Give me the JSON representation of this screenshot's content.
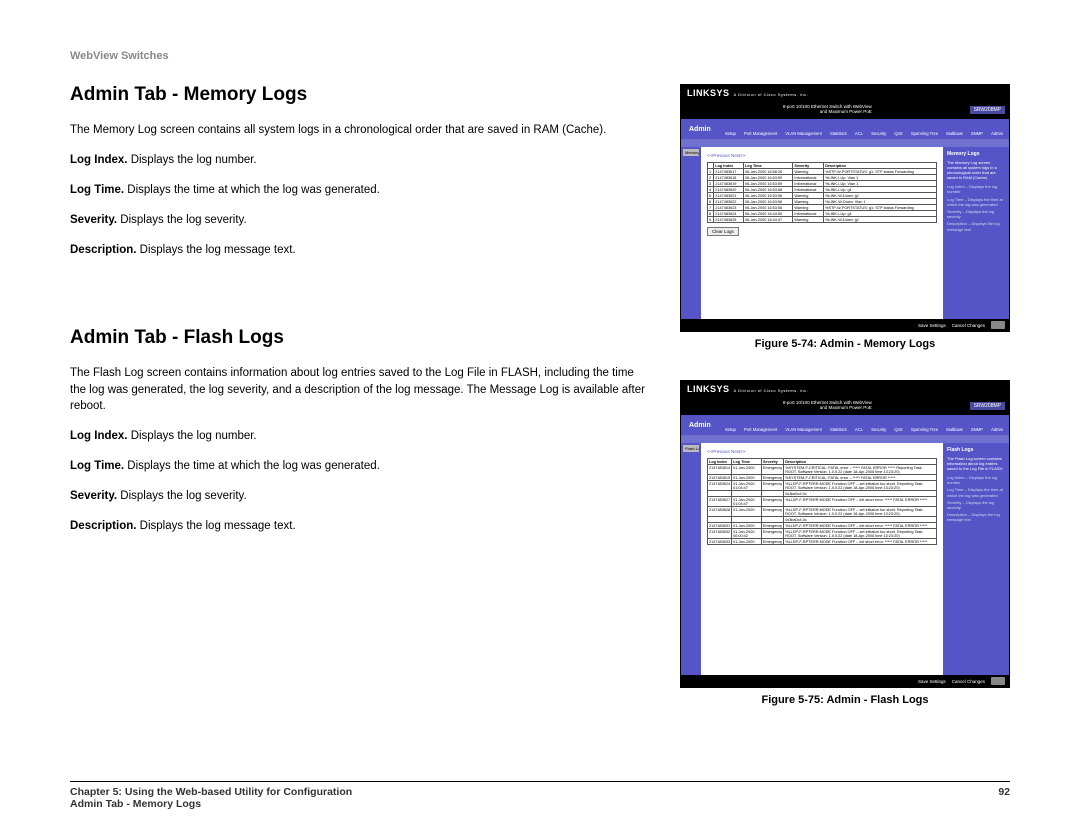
{
  "header_label": "WebView Switches",
  "section1": {
    "title": "Admin Tab - Memory Logs",
    "intro": "The Memory Log screen contains all system logs in a chronological order that are saved in RAM (Cache).",
    "fields": [
      {
        "label": "Log Index.",
        "text": " Displays the log number."
      },
      {
        "label": "Log Time.",
        "text": " Displays the time at which the log was generated."
      },
      {
        "label": "Severity.",
        "text": " Displays the log severity."
      },
      {
        "label": "Description.",
        "text": " Displays the log message text."
      }
    ]
  },
  "section2": {
    "title": "Admin Tab - Flash Logs",
    "intro": "The Flash Log screen contains information about log entries saved to the Log File in FLASH, including the time the log was generated, the log severity, and a description of the log message. The Message Log is available after reboot.",
    "fields": [
      {
        "label": "Log Index.",
        "text": " Displays the log number."
      },
      {
        "label": "Log Time.",
        "text": " Displays the time at which the log was generated."
      },
      {
        "label": "Severity.",
        "text": " Displays the log severity."
      },
      {
        "label": "Description.",
        "text": " Displays the log message text."
      }
    ]
  },
  "figures": {
    "fig1_caption": "Figure 5-74: Admin - Memory Logs",
    "fig2_caption": "Figure 5-75: Admin - Flash Logs"
  },
  "mock": {
    "brand": "LINKSYS",
    "subbrand": "A Division of Cisco Systems, Inc.",
    "product_line1": "8-port 10/100 Ethernet Switch with WebView",
    "product_line2": "and Maximum Power PoE",
    "model": "SRW208MP",
    "admin_label": "Admin",
    "tabs": [
      "Setup",
      "Port Management",
      "VLAN Management",
      "Statistics",
      "ACL",
      "Security",
      "QoS",
      "Spanning Tree",
      "Multicast",
      "SNMP",
      "Admin"
    ],
    "rail_label_memory": "Memory Logs",
    "rail_label_flash": "Flash Logs",
    "pager": "<<Previous   Next>>",
    "right_panel": {
      "memory_title": "Memory Logs",
      "memory_desc": "The Memory Log screen contains all system logs in a chronological order that are saved in RAM (Cache).",
      "flash_title": "Flash Logs",
      "flash_desc": "The Flash Log screen contains information about log entries saved to the Log File in FLASH.",
      "links": [
        "Log Index – Displays the log number",
        "Log Time – Displays the time at which the log was generated",
        "Severity – Displays the log severity",
        "Description – Displays the log message text"
      ]
    },
    "memory_table": {
      "headers": [
        "",
        "Log Index",
        "Log Time",
        "Severity",
        "Description"
      ],
      "rows": [
        [
          "1",
          "2147483617",
          "06-Jan-2000 16:58:26",
          "Warning",
          "%STP-W-PORTSTATUS: g1: STP status Forwarding"
        ],
        [
          "2",
          "2147483618",
          "06-Jan-2000 16:53:59",
          "Informational",
          "%LINK-I-Up: Vlan 1"
        ],
        [
          "3",
          "2147483619",
          "06-Jan-2000 16:53:59",
          "Informational",
          "%LINK-I-Up: Vlan 1"
        ],
        [
          "4",
          "2147483620",
          "06-Jan-2000 16:53:58",
          "Informational",
          "%LINK-I-Up: g1"
        ],
        [
          "5",
          "2147483621",
          "06-Jan-2000 16:53:56",
          "Warning",
          "%LINK-W-Down: g1"
        ],
        [
          "6",
          "2147483622",
          "06-Jan-2000 16:53:56",
          "Warning",
          "%LINK-W-Down: Vlan 1"
        ],
        [
          "7",
          "2147483623",
          "06-Jan-2000 16:53:56",
          "Warning",
          "%STP-W-PORTSTATUS: g1: STP status Forwarding"
        ],
        [
          "8",
          "2147483624",
          "06-Jan-2000 16:44:50",
          "Informational",
          "%LINK-I-Up: g1"
        ],
        [
          "9",
          "2147483625",
          "06-Jan-2000 16:44:47",
          "Warning",
          "%LINK-W-Down: g1"
        ]
      ]
    },
    "flash_table": {
      "headers": [
        "Log Index",
        "Log Time",
        "Severity",
        "Description"
      ],
      "rows": [
        [
          "2147483614",
          "01-Jan-2000",
          "Emergency",
          "%SYSTEM-F-CRITICAL: FATAL error – ***** FATAL ERROR ***** Reporting Task: ROOT. Software Version: 1.0.0.22 (date 18-Apr-2006 time 13:23:20)"
        ],
        [
          "2147483615",
          "01-Jan-2000",
          "Emergency",
          "%SYSTEM-F-CRITICAL: FATAL error – ***** FATAL ERROR *****"
        ],
        [
          "2147483624",
          "01-Jan-2000 01:04:47",
          "Emergency",
          "%LLDP-F-RPTERR:MODE Function OFF – set initialize too short. Reporting Task: ROOT. Software Version: 1.0.0.22 (date 18-Apr-2006 time 13:23:20)"
        ],
        [
          "",
          "",
          "",
          "0x3ba0c4,0c"
        ],
        [
          "2147483627",
          "01-Jan-2000 01:04:47",
          "Emergency",
          "%LLDP-F-RPTERR:MODE Function OFF – init short error. ***** FATAL ERROR *****"
        ],
        [
          "2147483628",
          "01-Jan-2000",
          "Emergency",
          "%LLDP-F-RPTERR:MODE Function OFF – set initialize too short. Reporting Task: ROOT. Software Version: 1.0.0.22 (date 18-Apr-2006 time 13:23:20)"
        ],
        [
          "",
          "",
          "",
          "0x3ba0c4,0c"
        ],
        [
          "2147483631",
          "01-Jan-2000",
          "Emergency",
          "%LLDP-F-RPTERR:MODE Function OFF – init short error. ***** FATAL ERROR *****"
        ],
        [
          "2147483632",
          "01-Jan-2000 00:00:42",
          "Emergency",
          "%LLDP-F-RPTERR:MODE Function OFF – set initialize too short. Reporting Task: ROOT. Software Version: 1.0.0.22 (date 18-Apr-2006 time 13:23:20)"
        ],
        [
          "2147483633",
          "01-Jan-2000",
          "Emergency",
          "%LLDP-F-RPTERR:MODE Function OFF – init short error. ***** FATAL ERROR *****"
        ]
      ]
    },
    "clear_button": "Clear Logs",
    "footer_actions": [
      "Save Settings",
      "Cancel Changes"
    ]
  },
  "footer": {
    "chapter": "Chapter 5: Using the Web-based Utility for Configuration",
    "page_number": "92",
    "section_ref": "Admin Tab - Memory Logs"
  }
}
